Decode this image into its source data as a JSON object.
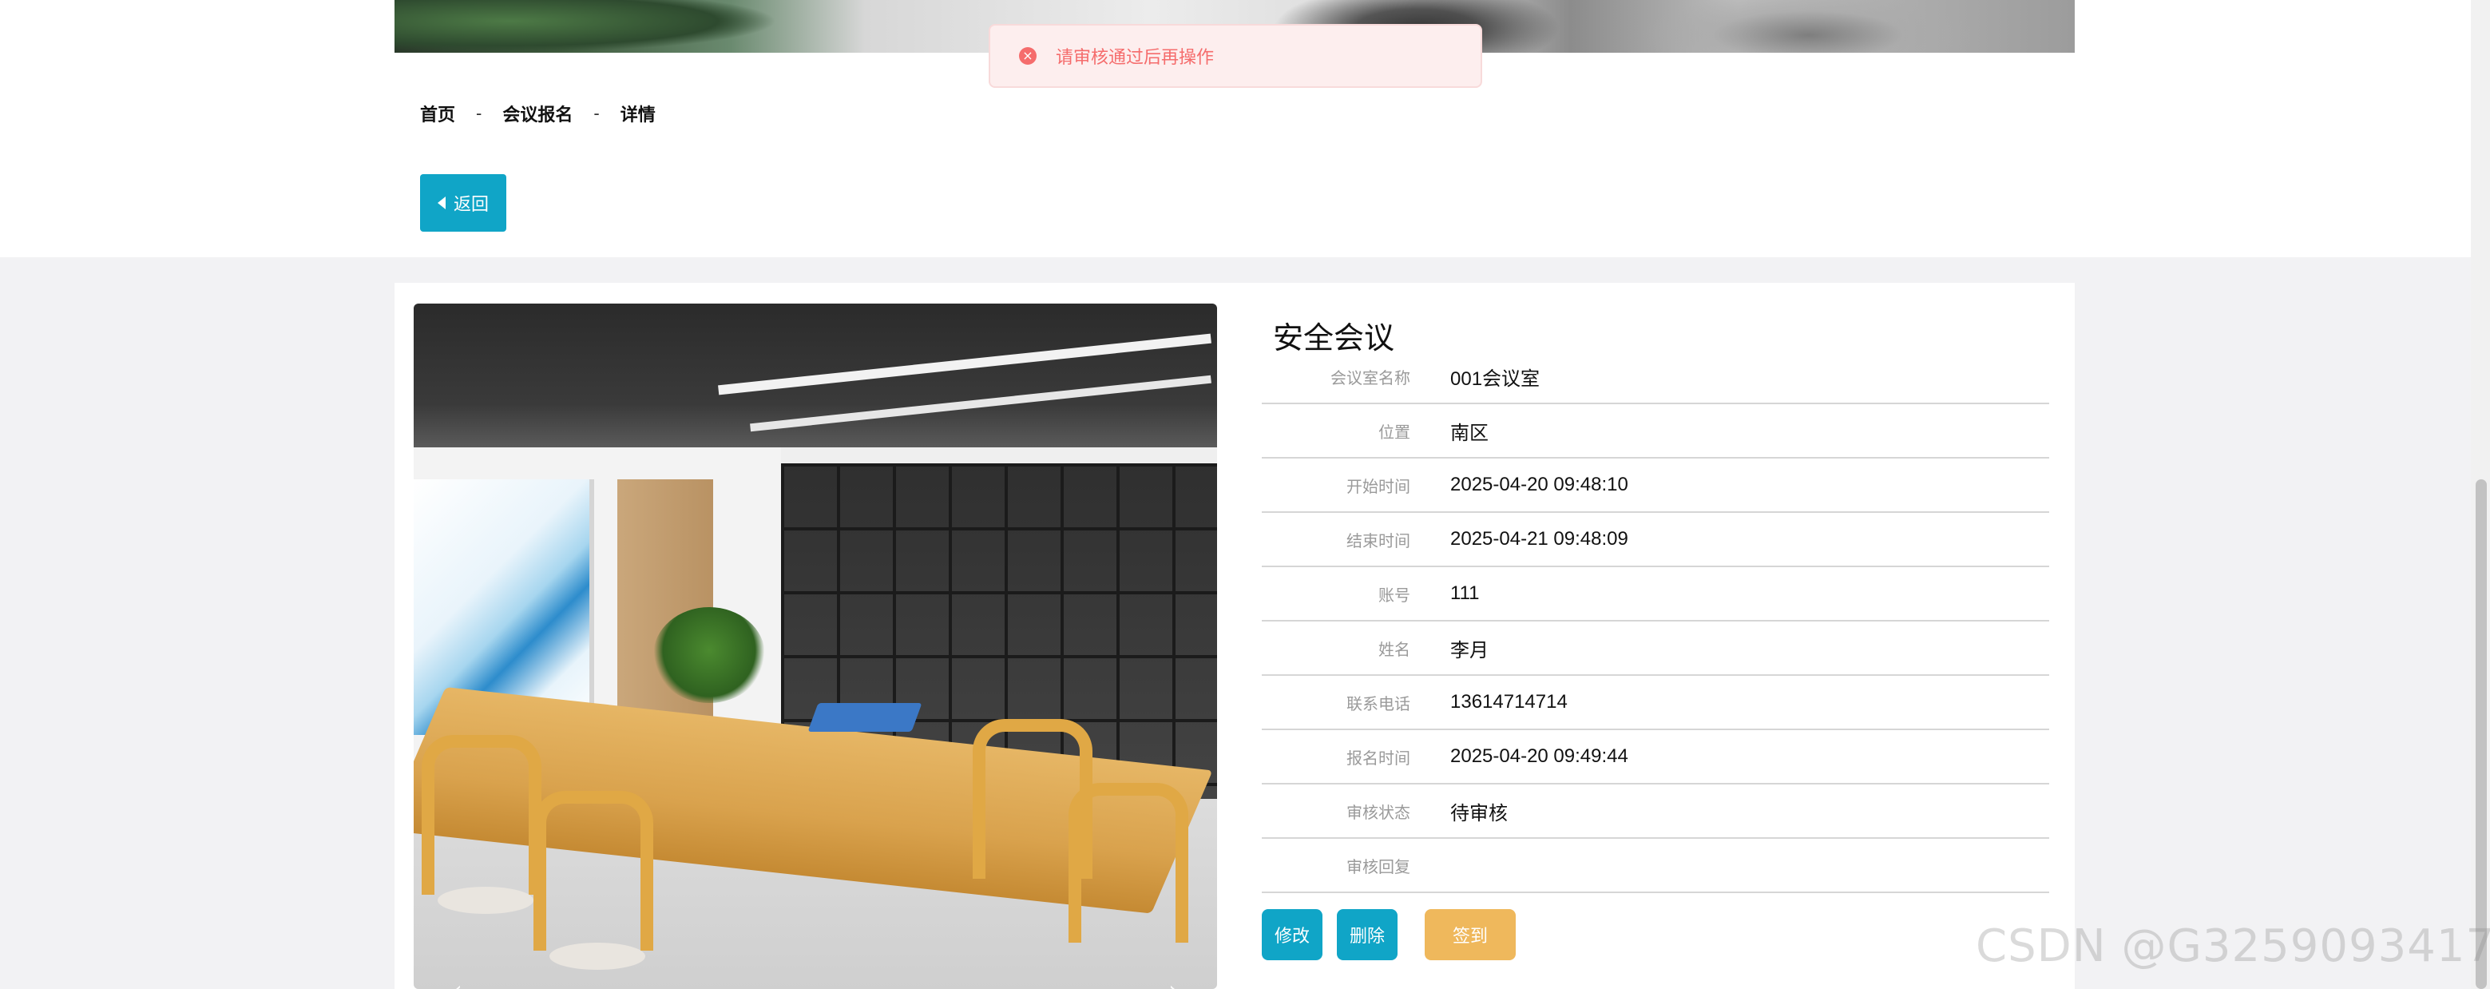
{
  "toast": {
    "message": "请审核通过后再操作",
    "icon": "error-circle-icon",
    "color": "#f56c6c"
  },
  "breadcrumb": {
    "items": [
      "首页",
      "会议报名",
      "详情"
    ],
    "separator": "-"
  },
  "back_button": {
    "label": "返回",
    "color": "#10a5c7"
  },
  "detail": {
    "title": "安全会议",
    "fields": [
      {
        "label": "会议室名称",
        "value": "001会议室"
      },
      {
        "label": "位置",
        "value": "南区"
      },
      {
        "label": "开始时间",
        "value": "2025-04-20 09:48:10"
      },
      {
        "label": "结束时间",
        "value": "2025-04-21 09:48:09"
      },
      {
        "label": "账号",
        "value": "111"
      },
      {
        "label": "姓名",
        "value": "李月"
      },
      {
        "label": "联系电话",
        "value": "13614714714"
      },
      {
        "label": "报名时间",
        "value": "2025-04-20 09:49:44"
      },
      {
        "label": "审核状态",
        "value": "待审核"
      },
      {
        "label": "审核回复",
        "value": ""
      }
    ]
  },
  "gallery": {
    "prev_glyph": "‹",
    "next_glyph": "›"
  },
  "actions": {
    "edit_label": "修改",
    "delete_label": "删除",
    "signin_label": "签到",
    "primary_color": "#10a5c7",
    "signin_color": "#efb85c"
  },
  "watermark": "CSDN @G3259093417"
}
